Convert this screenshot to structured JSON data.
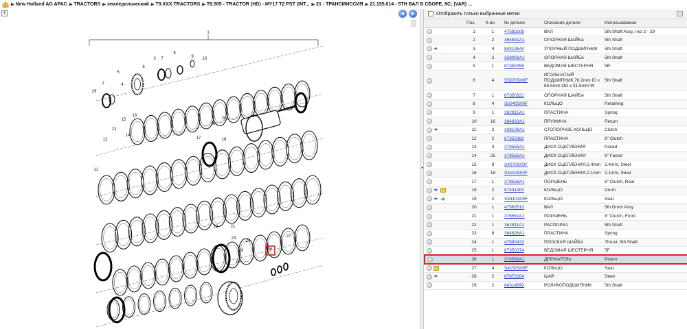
{
  "breadcrumb": [
    "New Holland AG APAC",
    "TRACTORS",
    "земледельческий",
    "T9.XXX TRACTORS",
    "T9.505 - TRACTOR (HD) - MY17 T2 PST (INT...",
    "21 - ТРАНСМИССИЯ",
    "21.155.014 - 5TH ВАЛ В СБОРЕ, 8С; (VAR) ..."
  ],
  "toolbar": {
    "expand": "+",
    "prev": "◂",
    "next": "▸"
  },
  "filter": {
    "label": "Отобразить только выбранные метки"
  },
  "diagram": {
    "callouts": [
      "1",
      "2",
      "3",
      "4",
      "5",
      "6",
      "7",
      "8",
      "9",
      "10",
      "11",
      "12",
      "13",
      "14",
      "15",
      "16",
      "17",
      "18",
      "19",
      "20",
      "21",
      "22",
      "23",
      "24",
      "25",
      "26",
      "27",
      "28",
      "29"
    ]
  },
  "table": {
    "headers": [
      "",
      "Поз.",
      "К-во",
      "№ детали",
      "Описание детали",
      "Использование"
    ],
    "rows": [
      {
        "pos": "1",
        "qty": "1",
        "part": "47582509",
        "desc": "ВАЛ",
        "usage": "5th Shaft Assy, Incl 2 - 29",
        "icons": []
      },
      {
        "pos": "2",
        "qty": "2",
        "part": "364831A1",
        "desc": "ОПОРНАЯ ШАЙБА",
        "usage": "5th Shaft",
        "icons": []
      },
      {
        "pos": "3",
        "qty": "4",
        "part": "84314644",
        "desc": "УПОРНЫЙ ПОДШИПНИК",
        "usage": "5th Shaft",
        "icons": [
          "blue"
        ]
      },
      {
        "pos": "4",
        "qty": "2",
        "part": "358908A1",
        "desc": "ОПОРНАЯ ШАЙБА",
        "usage": "5th Shaft",
        "icons": []
      },
      {
        "pos": "5",
        "qty": "1",
        "part": "87350355",
        "desc": "ВЕДОМАЯ ШЕСТЕРНЯ",
        "usage": "5R",
        "icons": []
      },
      {
        "pos": "6",
        "qty": "4",
        "part": "S5070S00F",
        "desc": "ИГОЛЬЧАТЫЙ ПОДШИПНИК,76.2mm ID x 85.5mm OD x 31.5mm W",
        "usage": "5th Shaft",
        "icons": [],
        "tall": true
      },
      {
        "pos": "7",
        "qty": "1",
        "part": "87350321",
        "desc": "ОПОРНАЯ ШАЙБА",
        "usage": "5th Shaft",
        "icons": []
      },
      {
        "pos": "8",
        "qty": "4",
        "part": "S5040S00F",
        "desc": "КОЛЬЦО",
        "usage": "Retaining",
        "icons": []
      },
      {
        "pos": "9",
        "qty": "1",
        "part": "362815A1",
        "desc": "ПЛАСТИНА",
        "usage": "Spring",
        "icons": []
      },
      {
        "pos": "10",
        "qty": "16",
        "part": "364833A1",
        "desc": "ПРУЖИНА",
        "usage": "Return",
        "icons": []
      },
      {
        "pos": "11",
        "qty": "2",
        "part": "428108A1",
        "desc": "СТОПОРНОЕ КОЛЬЦО",
        "usage": "Clutch",
        "icons": [
          "blue"
        ]
      },
      {
        "pos": "12",
        "qty": "2",
        "part": "87350360",
        "desc": "ПЛАСТИНА",
        "usage": "8\" Clutch",
        "icons": []
      },
      {
        "pos": "13",
        "qty": "4",
        "part": "378555A1",
        "desc": "ДИСК СЦЕПЛЕНИЯ",
        "usage": "Faced",
        "icons": []
      },
      {
        "pos": "14",
        "qty": "25",
        "part": "378556A1",
        "desc": "ДИСК СЦЕПЛЕНИЯ",
        "usage": "8\" Faced",
        "icons": []
      },
      {
        "pos": "15",
        "qty": "9",
        "part": "S4070S00F",
        "desc": "ДИСК СЦЕПЛЕНИЯ,2.4mm Thk",
        "usage": "2.4mm, Steel",
        "icons": []
      },
      {
        "pos": "16",
        "qty": "18",
        "part": "S4110S00F",
        "desc": "ДИСК СЦЕПЛЕНИЯ,2.1mm Thk",
        "usage": "2.1mm, Steel",
        "icons": []
      },
      {
        "pos": "17",
        "qty": "1",
        "part": "378558A1",
        "desc": "ПОРШЕНЬ",
        "usage": "8\" Clutch, Rear",
        "icons": []
      },
      {
        "pos": "18",
        "qty": "2",
        "part": "87431400",
        "desc": "КОЛЬЦО",
        "usage": "Drum",
        "icons": [
          "blue",
          "yellow"
        ]
      },
      {
        "pos": "19",
        "qty": "2",
        "part": "S4410S00F",
        "desc": "КОЛЬЦО",
        "usage": "Seal",
        "icons": [
          "blue",
          "green"
        ]
      },
      {
        "pos": "20",
        "qty": "1",
        "part": "47582512",
        "desc": "ВАЛ",
        "usage": "5th Drum Assy",
        "icons": []
      },
      {
        "pos": "21",
        "qty": "1",
        "part": "376562A1",
        "desc": "ПОРШЕНЬ",
        "usage": "8\" Clutch, Front",
        "icons": []
      },
      {
        "pos": "22",
        "qty": "1",
        "part": "362811A1",
        "desc": "РАСПОРКА",
        "usage": "5th Shaft",
        "icons": []
      },
      {
        "pos": "23",
        "qty": "8",
        "part": "364826A1",
        "desc": "ПЛАСТИНА",
        "usage": "Spring",
        "icons": []
      },
      {
        "pos": "24",
        "qty": "1",
        "part": "47582423",
        "desc": "ПЛОСКАЯ ШАЙБА",
        "usage": "Thrust, 5th Shaft",
        "icons": []
      },
      {
        "pos": "25",
        "qty": "1",
        "part": "87350374",
        "desc": "ВЕДОМАЯ ШЕСТЕРНЯ",
        "usage": "5F",
        "icons": []
      },
      {
        "pos": "26",
        "qty": "1",
        "part": "376568A1",
        "desc": "ДЕРЖАТЕЛЬ",
        "usage": "Piston",
        "icons": [],
        "selected": true
      },
      {
        "pos": "27",
        "qty": "4",
        "part": "S4150S00F",
        "desc": "КОЛЬЦО",
        "usage": "Seal",
        "icons": [
          "yellow"
        ]
      },
      {
        "pos": "28",
        "qty": "2",
        "part": "87672304",
        "desc": "ШАР",
        "usage": "Steel",
        "icons": [
          "blue"
        ]
      },
      {
        "pos": "29",
        "qty": "2",
        "part": "84314690",
        "desc": "РОЛИКОПОДШИПНИК",
        "usage": "5th Shaft",
        "icons": []
      }
    ]
  },
  "colors": {
    "link": "#1c35c8",
    "selection": "#e02020",
    "selected_bg": "#d9dde3"
  }
}
